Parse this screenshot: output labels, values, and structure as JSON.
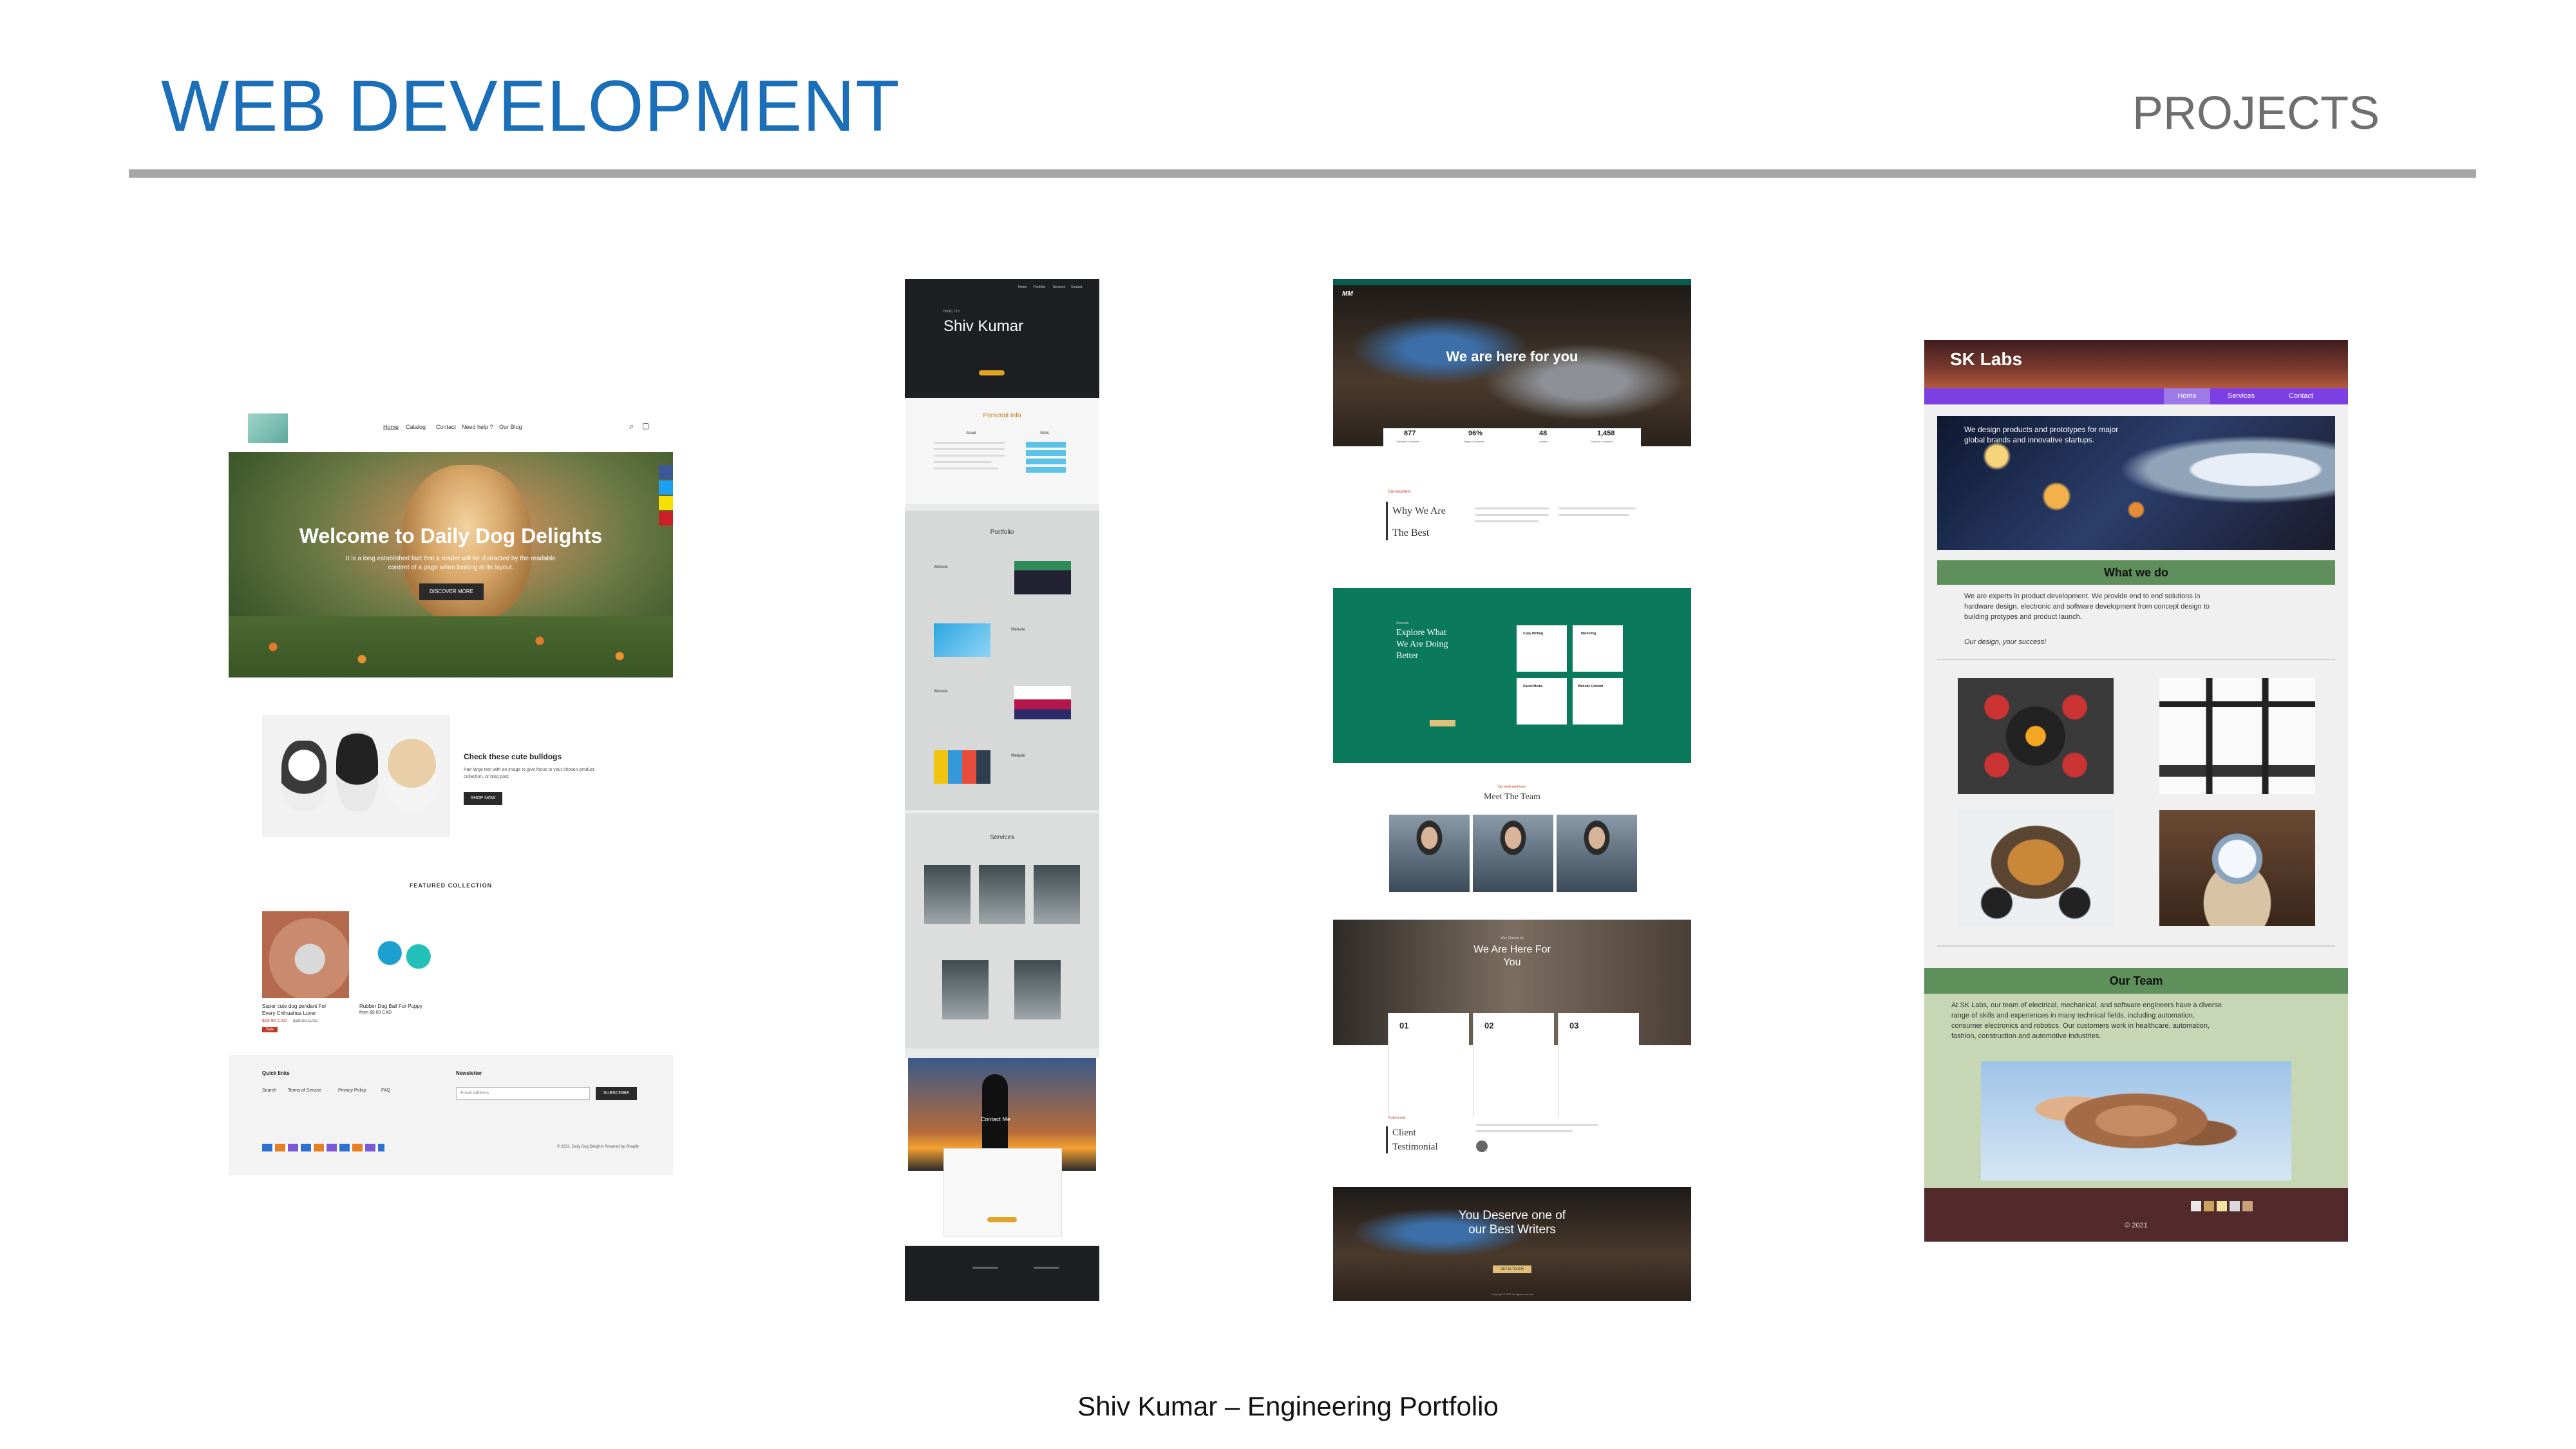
{
  "header": {
    "title": "WEB DEVELOPMENT",
    "section": "PROJECTS"
  },
  "footer": {
    "text": "Shiv Kumar – Engineering Portfolio"
  },
  "dog": {
    "nav": [
      "Home",
      "Catalog",
      "Contact",
      "Need help ?",
      "Our Blog"
    ],
    "hero_title": "Welcome to Daily Dog Delights",
    "hero_sub_1": "It is a long established fact that a reader will be distracted by the readable",
    "hero_sub_2": "content of a page when looking at its layout.",
    "hero_button": "DISCOVER MORE",
    "feature_title": "Check these cute bulldogs",
    "feature_text_1": "Pair large text with an image to give focus to your chosen product,",
    "feature_text_2": "collection, or blog post.",
    "feature_button": "SHOP NOW",
    "collection_heading": "FEATURED COLLECTION",
    "product1_name_1": "Super cute dog pendant For",
    "product1_name_2": "Every Chihuahua Lover",
    "product1_price": "$19.95 CAD",
    "product1_old_price": "$30.00 CAD",
    "product1_badge": "Sale",
    "product2_name": "Rubber Dog Ball For Puppy",
    "product2_price": "from $9.00 CAD",
    "quick_links_heading": "Quick links",
    "quick_links": [
      "Search",
      "Terms of Service",
      "Privacy Policy",
      "FAQ"
    ],
    "newsletter_heading": "Newsletter",
    "email_placeholder": "Email address",
    "subscribe": "SUBSCRIBE",
    "copyright": "© 2022, Daily Dog Delights Powered by Shopify"
  },
  "cv": {
    "nav": [
      "Home",
      "Portfolio",
      "Services",
      "Contact"
    ],
    "hello": "Hello, I'm",
    "name": "Shiv Kumar",
    "personal_info": "Personal Info",
    "about": "About",
    "skills": "Skills",
    "portfolio": "Portfolio",
    "item": "Website",
    "services": "Services",
    "contact": "Contact Me"
  },
  "mm": {
    "logo": "MM",
    "hero_title": "We are here for you",
    "stats": [
      {
        "value": "877",
        "label": "Satisfied Customers"
      },
      {
        "value": "96%",
        "label": "Happy Customers"
      },
      {
        "value": "48",
        "label": "Awards"
      },
      {
        "value": "1,458",
        "label": "Projects Completed"
      }
    ],
    "why_kicker": "Our excellent",
    "why_title_1": "Why We Are",
    "why_title_2": "The Best",
    "explore_kicker": "Services",
    "explore_1": "Explore What",
    "explore_2": "We Are Doing",
    "explore_3": "Better",
    "services": [
      "Copy Writing",
      "Marketing",
      "Social Media",
      "Website Content"
    ],
    "team_kicker": "Our dedicated team",
    "team_title": "Meet The Team",
    "here_kicker": "Why Choose Us",
    "here_1": "We Are Here For",
    "here_2": "You",
    "steps": [
      "01",
      "02",
      "03"
    ],
    "client_kicker": "Testimonials",
    "client_1": "Client",
    "client_2": "Testimonial",
    "deserve_1": "You Deserve one of",
    "deserve_2": "our Best Writers",
    "deserve_button": "GET IN TOUCH",
    "copyright": "Copyright © 2021 All rights reserved"
  },
  "sk": {
    "logo": "SK Labs",
    "nav": [
      "Home",
      "Services",
      "Contact"
    ],
    "hero_1": "We design products and prototypes for major",
    "hero_2": "global brands and innovative startups.",
    "what_heading": "What we do",
    "what_1": "We are experts in product development. We provide end to end solutions in",
    "what_2": "hardware design, electronic and software development from concept design to",
    "what_3": "building protypes and product launch.",
    "tagline": "Our design, your success!",
    "team_heading": "Our Team",
    "team_1": "At SK Labs, our team of electrical, mechanical, and software engineers have a diverse",
    "team_2": "range of skills and experiences in many technical fields, including automation,",
    "team_3": "consumer electronics and robotics. Our customers work in healthcare, automation,",
    "team_4": "fashion, construction and automotive industries.",
    "copyright": "© 2021"
  }
}
